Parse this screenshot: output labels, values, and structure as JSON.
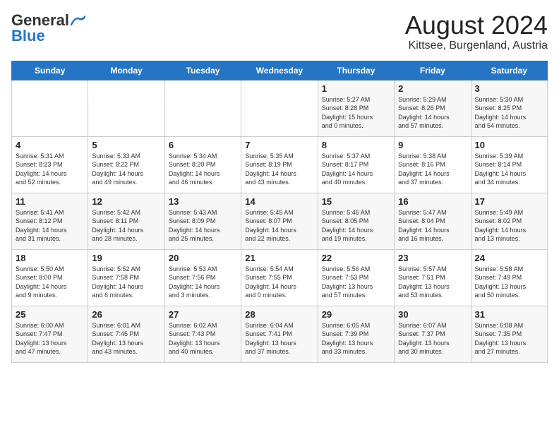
{
  "header": {
    "logo_general": "General",
    "logo_blue": "Blue",
    "month_year": "August 2024",
    "location": "Kittsee, Burgenland, Austria"
  },
  "weekdays": [
    "Sunday",
    "Monday",
    "Tuesday",
    "Wednesday",
    "Thursday",
    "Friday",
    "Saturday"
  ],
  "weeks": [
    [
      {
        "day": "",
        "info": ""
      },
      {
        "day": "",
        "info": ""
      },
      {
        "day": "",
        "info": ""
      },
      {
        "day": "",
        "info": ""
      },
      {
        "day": "1",
        "info": "Sunrise: 5:27 AM\nSunset: 8:28 PM\nDaylight: 15 hours\nand 0 minutes."
      },
      {
        "day": "2",
        "info": "Sunrise: 5:29 AM\nSunset: 8:26 PM\nDaylight: 14 hours\nand 57 minutes."
      },
      {
        "day": "3",
        "info": "Sunrise: 5:30 AM\nSunset: 8:25 PM\nDaylight: 14 hours\nand 54 minutes."
      }
    ],
    [
      {
        "day": "4",
        "info": "Sunrise: 5:31 AM\nSunset: 8:23 PM\nDaylight: 14 hours\nand 52 minutes."
      },
      {
        "day": "5",
        "info": "Sunrise: 5:33 AM\nSunset: 8:22 PM\nDaylight: 14 hours\nand 49 minutes."
      },
      {
        "day": "6",
        "info": "Sunrise: 5:34 AM\nSunset: 8:20 PM\nDaylight: 14 hours\nand 46 minutes."
      },
      {
        "day": "7",
        "info": "Sunrise: 5:35 AM\nSunset: 8:19 PM\nDaylight: 14 hours\nand 43 minutes."
      },
      {
        "day": "8",
        "info": "Sunrise: 5:37 AM\nSunset: 8:17 PM\nDaylight: 14 hours\nand 40 minutes."
      },
      {
        "day": "9",
        "info": "Sunrise: 5:38 AM\nSunset: 8:16 PM\nDaylight: 14 hours\nand 37 minutes."
      },
      {
        "day": "10",
        "info": "Sunrise: 5:39 AM\nSunset: 8:14 PM\nDaylight: 14 hours\nand 34 minutes."
      }
    ],
    [
      {
        "day": "11",
        "info": "Sunrise: 5:41 AM\nSunset: 8:12 PM\nDaylight: 14 hours\nand 31 minutes."
      },
      {
        "day": "12",
        "info": "Sunrise: 5:42 AM\nSunset: 8:11 PM\nDaylight: 14 hours\nand 28 minutes."
      },
      {
        "day": "13",
        "info": "Sunrise: 5:43 AM\nSunset: 8:09 PM\nDaylight: 14 hours\nand 25 minutes."
      },
      {
        "day": "14",
        "info": "Sunrise: 5:45 AM\nSunset: 8:07 PM\nDaylight: 14 hours\nand 22 minutes."
      },
      {
        "day": "15",
        "info": "Sunrise: 5:46 AM\nSunset: 8:05 PM\nDaylight: 14 hours\nand 19 minutes."
      },
      {
        "day": "16",
        "info": "Sunrise: 5:47 AM\nSunset: 8:04 PM\nDaylight: 14 hours\nand 16 minutes."
      },
      {
        "day": "17",
        "info": "Sunrise: 5:49 AM\nSunset: 8:02 PM\nDaylight: 14 hours\nand 13 minutes."
      }
    ],
    [
      {
        "day": "18",
        "info": "Sunrise: 5:50 AM\nSunset: 8:00 PM\nDaylight: 14 hours\nand 9 minutes."
      },
      {
        "day": "19",
        "info": "Sunrise: 5:52 AM\nSunset: 7:58 PM\nDaylight: 14 hours\nand 6 minutes."
      },
      {
        "day": "20",
        "info": "Sunrise: 5:53 AM\nSunset: 7:56 PM\nDaylight: 14 hours\nand 3 minutes."
      },
      {
        "day": "21",
        "info": "Sunrise: 5:54 AM\nSunset: 7:55 PM\nDaylight: 14 hours\nand 0 minutes."
      },
      {
        "day": "22",
        "info": "Sunrise: 5:56 AM\nSunset: 7:53 PM\nDaylight: 13 hours\nand 57 minutes."
      },
      {
        "day": "23",
        "info": "Sunrise: 5:57 AM\nSunset: 7:51 PM\nDaylight: 13 hours\nand 53 minutes."
      },
      {
        "day": "24",
        "info": "Sunrise: 5:58 AM\nSunset: 7:49 PM\nDaylight: 13 hours\nand 50 minutes."
      }
    ],
    [
      {
        "day": "25",
        "info": "Sunrise: 6:00 AM\nSunset: 7:47 PM\nDaylight: 13 hours\nand 47 minutes."
      },
      {
        "day": "26",
        "info": "Sunrise: 6:01 AM\nSunset: 7:45 PM\nDaylight: 13 hours\nand 43 minutes."
      },
      {
        "day": "27",
        "info": "Sunrise: 6:02 AM\nSunset: 7:43 PM\nDaylight: 13 hours\nand 40 minutes."
      },
      {
        "day": "28",
        "info": "Sunrise: 6:04 AM\nSunset: 7:41 PM\nDaylight: 13 hours\nand 37 minutes."
      },
      {
        "day": "29",
        "info": "Sunrise: 6:05 AM\nSunset: 7:39 PM\nDaylight: 13 hours\nand 33 minutes."
      },
      {
        "day": "30",
        "info": "Sunrise: 6:07 AM\nSunset: 7:37 PM\nDaylight: 13 hours\nand 30 minutes."
      },
      {
        "day": "31",
        "info": "Sunrise: 6:08 AM\nSunset: 7:35 PM\nDaylight: 13 hours\nand 27 minutes."
      }
    ]
  ]
}
